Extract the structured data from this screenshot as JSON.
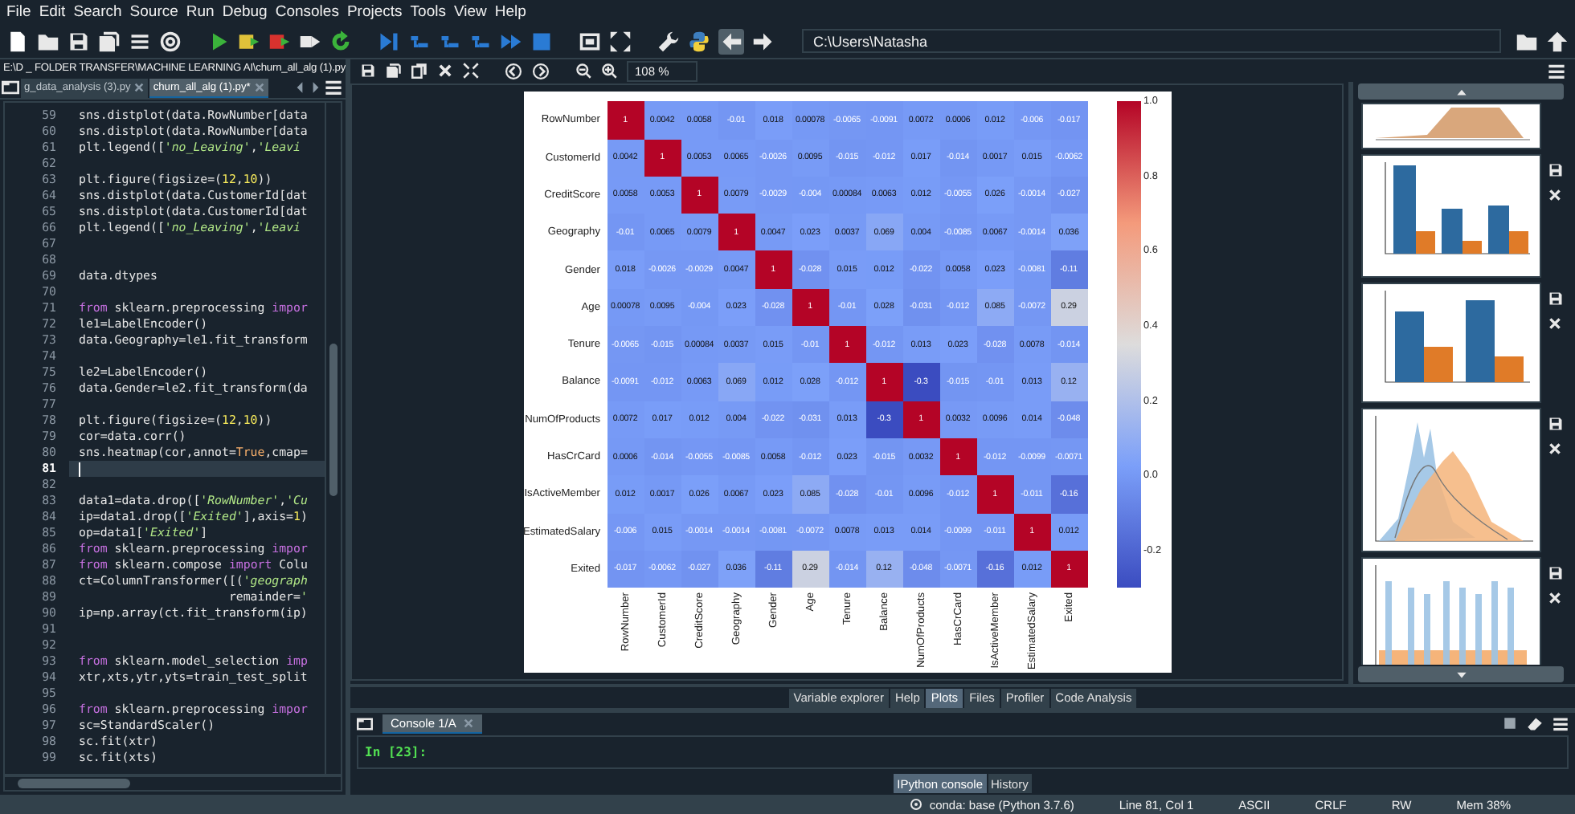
{
  "menu": [
    "File",
    "Edit",
    "Search",
    "Source",
    "Run",
    "Debug",
    "Consoles",
    "Projects",
    "Tools",
    "View",
    "Help"
  ],
  "toolbar": {
    "path": "C:\\Users\\Natasha"
  },
  "editor": {
    "file_path": "E:\\D _ FOLDER TRANSFER\\MACHINE LEARNING AI\\churn_all_alg (1).py",
    "tabs": [
      {
        "label": "g_data_analysis (3).py",
        "selected": false
      },
      {
        "label": "churn_all_alg (1).py*",
        "selected": true
      }
    ],
    "lines": [
      {
        "number": "59",
        "current": false,
        "segments": [
          {
            "text": "sns.distplot(data.RowNumber[data",
            "kind": "code"
          }
        ]
      },
      {
        "number": "60",
        "current": false,
        "segments": [
          {
            "text": "sns.distplot(data.RowNumber[data",
            "kind": "code"
          }
        ]
      },
      {
        "number": "61",
        "current": false,
        "segments": [
          {
            "text": "plt.legend([",
            "kind": "code"
          },
          {
            "text": "'no_Leaving'",
            "kind": "string"
          },
          {
            "text": ",",
            "kind": "code"
          },
          {
            "text": "'Leavi",
            "kind": "string"
          }
        ]
      },
      {
        "number": "62",
        "current": false
      },
      {
        "number": "63",
        "current": false,
        "segments": [
          {
            "text": "plt.figure(figsize=(",
            "kind": "code"
          },
          {
            "text": "12",
            "kind": "number"
          },
          {
            "text": ",",
            "kind": "code"
          },
          {
            "text": "10",
            "kind": "number"
          },
          {
            "text": "))",
            "kind": "code"
          }
        ]
      },
      {
        "number": "64",
        "current": false,
        "segments": [
          {
            "text": "sns.distplot(data.CustomerId[dat",
            "kind": "code"
          }
        ]
      },
      {
        "number": "65",
        "current": false,
        "segments": [
          {
            "text": "sns.distplot(data.CustomerId[dat",
            "kind": "code"
          }
        ]
      },
      {
        "number": "66",
        "current": false,
        "segments": [
          {
            "text": "plt.legend([",
            "kind": "code"
          },
          {
            "text": "'no_Leaving'",
            "kind": "string"
          },
          {
            "text": ",",
            "kind": "code"
          },
          {
            "text": "'Leavi",
            "kind": "string"
          }
        ]
      },
      {
        "number": "67",
        "current": false
      },
      {
        "number": "68",
        "current": false
      },
      {
        "number": "69",
        "current": false,
        "segments": [
          {
            "text": "data.dtypes",
            "kind": "code"
          }
        ]
      },
      {
        "number": "70",
        "current": false
      },
      {
        "number": "71",
        "current": false,
        "segments": [
          {
            "text": "from",
            "kind": "keyword"
          },
          {
            "text": " sklearn.preprocessing ",
            "kind": "code"
          },
          {
            "text": "impor",
            "kind": "keyword"
          }
        ]
      },
      {
        "number": "72",
        "current": false,
        "segments": [
          {
            "text": "le1=LabelEncoder()",
            "kind": "code"
          }
        ]
      },
      {
        "number": "73",
        "current": false,
        "segments": [
          {
            "text": "data.Geography=le1.fit_transform",
            "kind": "code"
          }
        ]
      },
      {
        "number": "74",
        "current": false
      },
      {
        "number": "75",
        "current": false,
        "segments": [
          {
            "text": "le2=LabelEncoder()",
            "kind": "code"
          }
        ]
      },
      {
        "number": "76",
        "current": false,
        "segments": [
          {
            "text": "data.Gender=le2.fit_transform(da",
            "kind": "code"
          }
        ]
      },
      {
        "number": "77",
        "current": false
      },
      {
        "number": "78",
        "current": false,
        "segments": [
          {
            "text": "plt.figure(figsize=(",
            "kind": "code"
          },
          {
            "text": "12",
            "kind": "number"
          },
          {
            "text": ",",
            "kind": "code"
          },
          {
            "text": "10",
            "kind": "number"
          },
          {
            "text": "))",
            "kind": "code"
          }
        ]
      },
      {
        "number": "79",
        "current": false,
        "segments": [
          {
            "text": "cor=data.corr()",
            "kind": "code"
          }
        ]
      },
      {
        "number": "80",
        "current": false,
        "segments": [
          {
            "text": "sns.heatmap(cor,annot=",
            "kind": "code"
          },
          {
            "text": "True",
            "kind": "builtin"
          },
          {
            "text": ",cmap=",
            "kind": "code"
          }
        ]
      },
      {
        "number": "81",
        "current": true
      },
      {
        "number": "82",
        "current": false
      },
      {
        "number": "83",
        "current": false,
        "segments": [
          {
            "text": "data1=data.drop([",
            "kind": "code"
          },
          {
            "text": "'RowNumber'",
            "kind": "string"
          },
          {
            "text": ",",
            "kind": "code"
          },
          {
            "text": "'Cu",
            "kind": "string"
          }
        ]
      },
      {
        "number": "84",
        "current": false,
        "segments": [
          {
            "text": "ip=data1.drop([",
            "kind": "code"
          },
          {
            "text": "'Exited'",
            "kind": "string"
          },
          {
            "text": "],axis=",
            "kind": "code"
          },
          {
            "text": "1",
            "kind": "number"
          },
          {
            "text": ")",
            "kind": "code"
          }
        ]
      },
      {
        "number": "85",
        "current": false,
        "segments": [
          {
            "text": "op=data1[",
            "kind": "code"
          },
          {
            "text": "'Exited'",
            "kind": "string"
          },
          {
            "text": "]",
            "kind": "code"
          }
        ]
      },
      {
        "number": "86",
        "current": false,
        "segments": [
          {
            "text": "from",
            "kind": "keyword"
          },
          {
            "text": " sklearn.preprocessing ",
            "kind": "code"
          },
          {
            "text": "impor",
            "kind": "keyword"
          }
        ]
      },
      {
        "number": "87",
        "current": false,
        "segments": [
          {
            "text": "from",
            "kind": "keyword"
          },
          {
            "text": " sklearn.compose ",
            "kind": "code"
          },
          {
            "text": "import",
            "kind": "keyword"
          },
          {
            "text": " Colu",
            "kind": "code"
          }
        ]
      },
      {
        "number": "88",
        "current": false,
        "segments": [
          {
            "text": "ct=ColumnTransformer([(",
            "kind": "code"
          },
          {
            "text": "'geograph",
            "kind": "string"
          }
        ]
      },
      {
        "number": "89",
        "current": false,
        "segments": [
          {
            "text": "                     remainder=",
            "kind": "code"
          },
          {
            "text": "'",
            "kind": "string"
          }
        ]
      },
      {
        "number": "90",
        "current": false,
        "segments": [
          {
            "text": "ip=np.array(ct.fit_transform(ip)",
            "kind": "code"
          }
        ]
      },
      {
        "number": "91",
        "current": false
      },
      {
        "number": "92",
        "current": false
      },
      {
        "number": "93",
        "current": false,
        "segments": [
          {
            "text": "from",
            "kind": "keyword"
          },
          {
            "text": " sklearn.model_selection ",
            "kind": "code"
          },
          {
            "text": "imp",
            "kind": "keyword"
          }
        ]
      },
      {
        "number": "94",
        "current": false,
        "segments": [
          {
            "text": "xtr,xts,ytr,yts=train_test_split",
            "kind": "code"
          }
        ]
      },
      {
        "number": "95",
        "current": false
      },
      {
        "number": "96",
        "current": false,
        "segments": [
          {
            "text": "from",
            "kind": "keyword"
          },
          {
            "text": " sklearn.preprocessing ",
            "kind": "code"
          },
          {
            "text": "impor",
            "kind": "keyword"
          }
        ]
      },
      {
        "number": "97",
        "current": false,
        "segments": [
          {
            "text": "sc=StandardScaler()",
            "kind": "code"
          }
        ]
      },
      {
        "number": "98",
        "current": false,
        "segments": [
          {
            "text": "sc.fit(xtr)",
            "kind": "code"
          }
        ]
      },
      {
        "number": "99",
        "current": false,
        "segments": [
          {
            "text": "sc.fit(xts)",
            "kind": "code"
          }
        ]
      }
    ]
  },
  "plots": {
    "zoom": "108 %",
    "heatmap": {
      "row_labels": [
        "RowNumber",
        "CustomerId",
        "CreditScore",
        "Geography",
        "Gender",
        "Age",
        "Tenure",
        "Balance",
        "NumOfProducts",
        "HasCrCard",
        "IsActiveMember",
        "EstimatedSalary",
        "Exited"
      ],
      "column_labels": [
        "RowNumber",
        "CustomerId",
        "CreditScore",
        "Geography",
        "Gender",
        "Age",
        "Tenure",
        "Balance",
        "NumOfProducts",
        "HasCrCard",
        "IsActiveMember",
        "EstimatedSalary",
        "Exited"
      ],
      "rows": [
        [
          "1",
          "0.0042",
          "0.0058",
          "-0.01",
          "0.018",
          "0.00078",
          "-0.0065",
          "-0.0091",
          "0.0072",
          "0.0006",
          "0.012",
          "-0.006",
          "-0.017"
        ],
        [
          "0.0042",
          "1",
          "0.0053",
          "0.0065",
          "-0.0026",
          "0.0095",
          "-0.015",
          "-0.012",
          "0.017",
          "-0.014",
          "0.0017",
          "0.015",
          "-0.0062"
        ],
        [
          "0.0058",
          "0.0053",
          "1",
          "0.0079",
          "-0.0029",
          "-0.004",
          "0.00084",
          "0.0063",
          "0.012",
          "-0.0055",
          "0.026",
          "-0.0014",
          "-0.027"
        ],
        [
          "-0.01",
          "0.0065",
          "0.0079",
          "1",
          "0.0047",
          "0.023",
          "0.0037",
          "0.069",
          "0.004",
          "-0.0085",
          "0.0067",
          "-0.0014",
          "0.036"
        ],
        [
          "0.018",
          "-0.0026",
          "-0.0029",
          "0.0047",
          "1",
          "-0.028",
          "0.015",
          "0.012",
          "-0.022",
          "0.0058",
          "0.023",
          "-0.0081",
          "-0.11"
        ],
        [
          "0.00078",
          "0.0095",
          "-0.004",
          "0.023",
          "-0.028",
          "1",
          "-0.01",
          "0.028",
          "-0.031",
          "-0.012",
          "0.085",
          "-0.0072",
          "0.29"
        ],
        [
          "-0.0065",
          "-0.015",
          "0.00084",
          "0.0037",
          "0.015",
          "-0.01",
          "1",
          "-0.012",
          "0.013",
          "0.023",
          "-0.028",
          "0.0078",
          "-0.014"
        ],
        [
          "-0.0091",
          "-0.012",
          "0.0063",
          "0.069",
          "0.012",
          "0.028",
          "-0.012",
          "1",
          "-0.3",
          "-0.015",
          "-0.01",
          "0.013",
          "0.12"
        ],
        [
          "0.0072",
          "0.017",
          "0.012",
          "0.004",
          "-0.022",
          "-0.031",
          "0.013",
          "-0.3",
          "1",
          "0.0032",
          "0.0096",
          "0.014",
          "-0.048"
        ],
        [
          "0.0006",
          "-0.014",
          "-0.0055",
          "-0.0085",
          "0.0058",
          "-0.012",
          "0.023",
          "-0.015",
          "0.0032",
          "1",
          "-0.012",
          "-0.0099",
          "-0.0071"
        ],
        [
          "0.012",
          "0.0017",
          "0.026",
          "0.0067",
          "0.023",
          "0.085",
          "-0.028",
          "-0.01",
          "0.0096",
          "-0.012",
          "1",
          "-0.011",
          "-0.16"
        ],
        [
          "-0.006",
          "0.015",
          "-0.0014",
          "-0.0014",
          "-0.0081",
          "-0.0072",
          "0.0078",
          "0.013",
          "0.014",
          "-0.0099",
          "-0.011",
          "1",
          "0.012"
        ],
        [
          "-0.017",
          "-0.0062",
          "-0.027",
          "0.036",
          "-0.11",
          "0.29",
          "-0.014",
          "0.12",
          "-0.048",
          "-0.0071",
          "-0.16",
          "0.012",
          "1"
        ]
      ],
      "colorbar_ticks": [
        "1.0",
        "0.8",
        "0.6",
        "0.4",
        "0.2",
        "0.0",
        "-0.2"
      ]
    }
  },
  "pane_tabs": [
    {
      "label": "Variable explorer",
      "selected": false
    },
    {
      "label": "Help",
      "selected": false
    },
    {
      "label": "Plots",
      "selected": true
    },
    {
      "label": "Files",
      "selected": false
    },
    {
      "label": "Profiler",
      "selected": false
    },
    {
      "label": "Code Analysis",
      "selected": false
    }
  ],
  "console": {
    "tabs": [
      {
        "label": "Console 1/A",
        "selected": true
      }
    ],
    "prompt": "In [23]:"
  },
  "console_tabs": [
    {
      "label": "IPython console",
      "selected": true
    },
    {
      "label": "History",
      "selected": false
    }
  ],
  "status_bar": [
    "conda: base (Python 3.7.6)",
    "Line 81, Col 1",
    "ASCII",
    "CRLF",
    "RW",
    "Mem 38%"
  ]
}
